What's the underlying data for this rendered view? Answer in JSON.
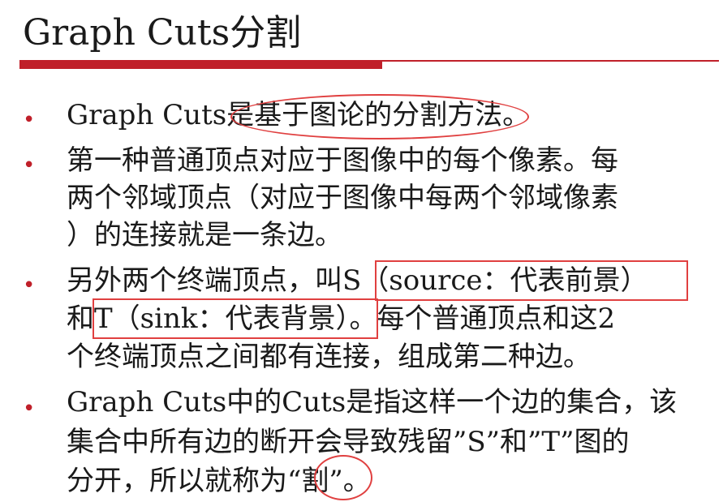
{
  "title": "Graph Cuts分割",
  "bullets": [
    {
      "lines": [
        "Graph Cuts是基于图论的分割方法。"
      ]
    },
    {
      "lines": [
        "第一种普通顶点对应于图像中的每个像素。每",
        "两个邻域顶点（对应于图像中每两个邻域像素",
        "）的连接就是一条边。"
      ]
    },
    {
      "lines": [
        "另外两个终端顶点，叫S（source：代表前景）",
        "和T（sink：代表背景）。每个普通顶点和这2",
        "个终端顶点之间都有连接，组成第二种边。"
      ]
    },
    {
      "lines": [
        "Graph Cuts中的Cuts是指这样一个边的集合，该",
        "集合中所有边的断开会导致残留”S”和”T”图的",
        "分开，所以就称为“割”。"
      ]
    }
  ],
  "annotation_color": "#e04040",
  "accent_color": "#c0202a"
}
